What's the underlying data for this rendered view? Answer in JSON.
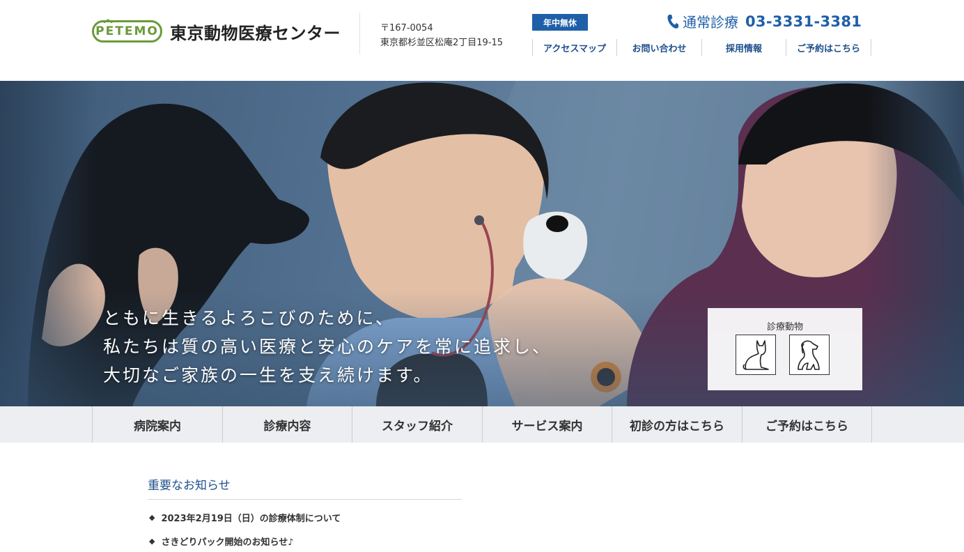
{
  "header": {
    "logo_text": "PETEMO",
    "clinic_name": "東京動物医療センター",
    "postal": "〒167-0054",
    "address": "東京都杉並区松庵2丁目19-15",
    "open_badge": "年中無休",
    "phone_label": "通常診療",
    "phone_number": "03-3331-3381",
    "utility_links": [
      "アクセスマップ",
      "お問い合わせ",
      "採用情報",
      "ご予約はこちら"
    ]
  },
  "hero": {
    "copy_lines": [
      "ともに生きるよろこびのために、",
      "私たちは質の高い医療と安心のケアを常に追求し、",
      "大切なご家族の一生を支え続けます。"
    ],
    "animals_title": "診療動物",
    "animals": [
      "cat-icon",
      "dog-icon"
    ]
  },
  "nav": {
    "items": [
      "病院案内",
      "診療内容",
      "スタッフ紹介",
      "サービス案内",
      "初診の方はこちら",
      "ご予約はこちら"
    ]
  },
  "notices": {
    "title": "重要なお知らせ",
    "items": [
      "2023年2月19日（日）の診療体制について",
      "さきどりパック開始のお知らせ♪"
    ]
  },
  "colors": {
    "brand_blue": "#1e5fa8",
    "logo_green": "#6a9a3a",
    "nav_bg": "#eceef1"
  }
}
